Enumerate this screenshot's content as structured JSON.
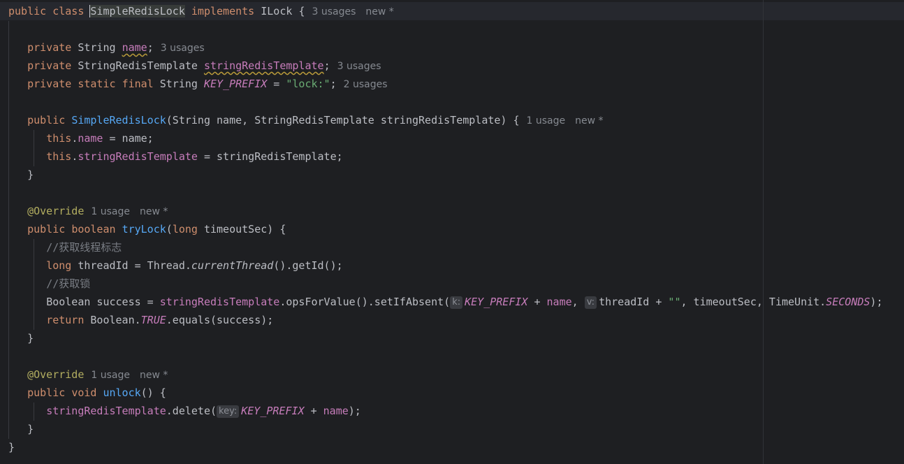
{
  "hints": {
    "usages_3": "3 usages",
    "usages_2": "2 usages",
    "usage_1": "1 usage",
    "new": "new *"
  },
  "param_hints": {
    "k": "k:",
    "v": "v:",
    "key": "key:"
  },
  "code": {
    "public": "public",
    "class": "class",
    "class_name": "SimpleRedisLock",
    "implements": "implements",
    "interface": "ILock",
    "open_brace": "{",
    "close_brace": "}",
    "private": "private",
    "static": "static",
    "final": "final",
    "String": "String",
    "StringRedisTemplate": "StringRedisTemplate",
    "name": "name",
    "stringRedisTemplate": "stringRedisTemplate",
    "key_prefix": "KEY_PREFIX",
    "assign": " = ",
    "lock_literal": "\"lock:\"",
    "semicolon": ";",
    "ctor_params_open": "(String name, StringRedisTemplate stringRedisTemplate) {",
    "this": "this",
    "dot": ".",
    "name_assign_rhs": " = name;",
    "srt_assign_rhs": " = stringRedisTemplate;",
    "override": "@Override",
    "boolean": "boolean",
    "tryLock": "tryLock",
    "long": "long",
    "trylock_params": " timeoutSec) {",
    "comment_thread": "//获取线程标志",
    "threadId_decl": " threadId = Thread.",
    "currentThread": "currentThread",
    "getId_call": "().getId();",
    "comment_lock": "//获取锁",
    "success_decl": "Boolean success = ",
    "ops_call": ".opsForValue().setIfAbsent(",
    "plus": " + ",
    "name_comma": ", ",
    "threadId_plus": "threadId + ",
    "empty_str": "\"\"",
    "timeout_part": ", timeoutSec, TimeUnit.",
    "seconds": "SECONDS",
    "close_paren_semi": ");",
    "return": "return",
    "boolean_class": " Boolean.",
    "true_const": "TRUE",
    "equals_call": ".equals(success);",
    "void": "void",
    "unlock": "unlock",
    "empty_params_open": "() {",
    "delete_call": ".delete("
  }
}
